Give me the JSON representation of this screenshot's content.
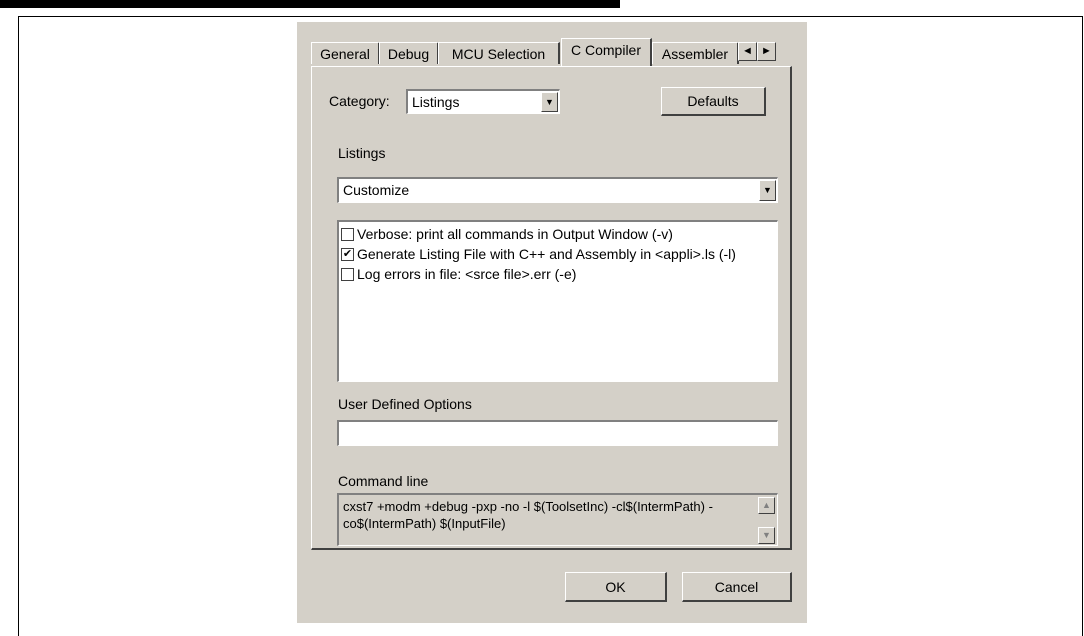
{
  "dialog": {
    "tabs": [
      {
        "label": "General"
      },
      {
        "label": "Debug"
      },
      {
        "label": "MCU Selection"
      },
      {
        "label": "C Compiler",
        "active": true
      },
      {
        "label": "Assembler"
      }
    ],
    "tab_scroll_left": "◄",
    "tab_scroll_right": "►",
    "category_label": "Category:",
    "category_value": "Listings",
    "defaults_button": "Defaults",
    "section_label": "Listings",
    "listings_mode": "Customize",
    "options": [
      {
        "label": "Verbose: print all commands in Output Window (-v)",
        "checked": false
      },
      {
        "label": "Generate Listing File with C++ and Assembly in <appli>.ls (-l)",
        "checked": true
      },
      {
        "label": "Log errors in file: <srce file>.err (-e)",
        "checked": false
      }
    ],
    "check_mark": "✔",
    "user_options_label": "User Defined Options",
    "user_options_value": "",
    "command_line_label": "Command line",
    "command_line": "cxst7 +modm +debug -pxp -no -l $(ToolsetInc) -cl$(IntermPath) -co$(IntermPath) $(InputFile)",
    "ok_button": "OK",
    "cancel_button": "Cancel",
    "dropdown_arrow": "▼",
    "scroll_up": "▲",
    "scroll_down": "▼"
  }
}
